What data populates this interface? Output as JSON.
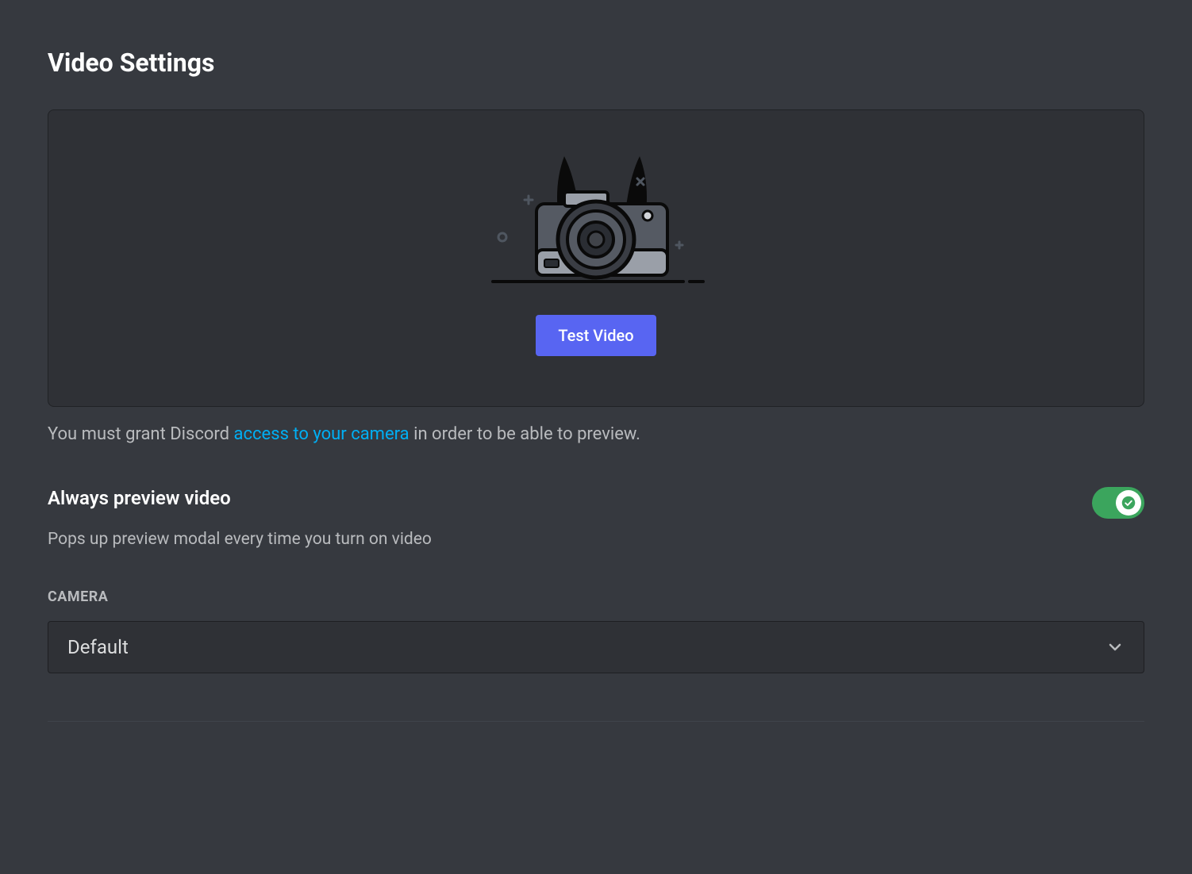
{
  "header": {
    "title": "Video Settings"
  },
  "preview": {
    "test_button_label": "Test Video"
  },
  "permission": {
    "prefix": "You must grant Discord ",
    "link_text": "access to your camera",
    "suffix": " in order to be able to preview."
  },
  "always_preview": {
    "label": "Always preview video",
    "description": "Pops up preview modal every time you turn on video",
    "enabled": true
  },
  "camera": {
    "section_label": "CAMERA",
    "selected": "Default"
  },
  "colors": {
    "accent": "#5865f2",
    "toggle_on": "#3ba55d",
    "link": "#00aff4"
  }
}
